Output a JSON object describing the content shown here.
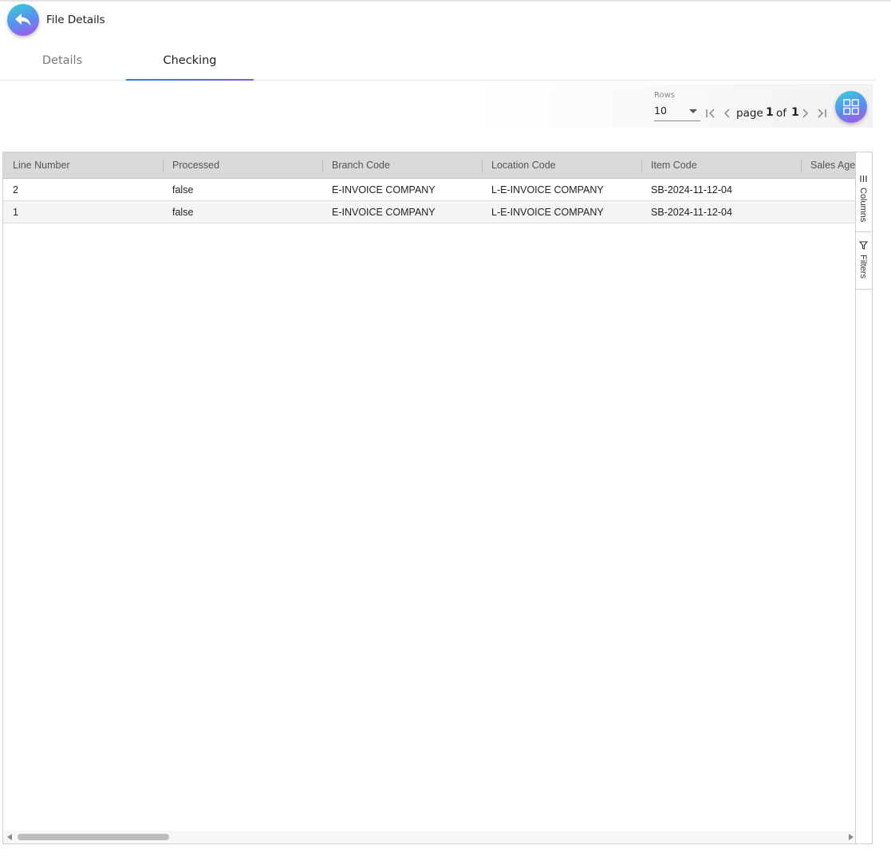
{
  "header": {
    "title": "File Details",
    "back_icon": "reply-arrow-icon"
  },
  "tabs": [
    {
      "label": "Details",
      "active": false
    },
    {
      "label": "Checking",
      "active": true
    }
  ],
  "toolbar": {
    "rows_label": "Rows",
    "rows_value": "10",
    "page_word": "page",
    "page_current": "1",
    "of_word": "of",
    "page_total": "1",
    "grid_icon": "grid-view-icon"
  },
  "table": {
    "columns": [
      "Line Number",
      "Processed",
      "Branch Code",
      "Location Code",
      "Item Code",
      "Sales Agent"
    ],
    "rows": [
      [
        "2",
        "false",
        "E-INVOICE COMPANY",
        "L-E-INVOICE COMPANY",
        "SB-2024-11-12-04",
        ""
      ],
      [
        "1",
        "false",
        "E-INVOICE COMPANY",
        "L-E-INVOICE COMPANY",
        "SB-2024-11-12-04",
        ""
      ]
    ]
  },
  "side_bar": {
    "columns_label": "Columns",
    "filters_label": "Filters"
  },
  "colors": {
    "accent_start": "#33d3d6",
    "accent_end": "#b24fe6",
    "tab_underline": "#2b7de9"
  }
}
